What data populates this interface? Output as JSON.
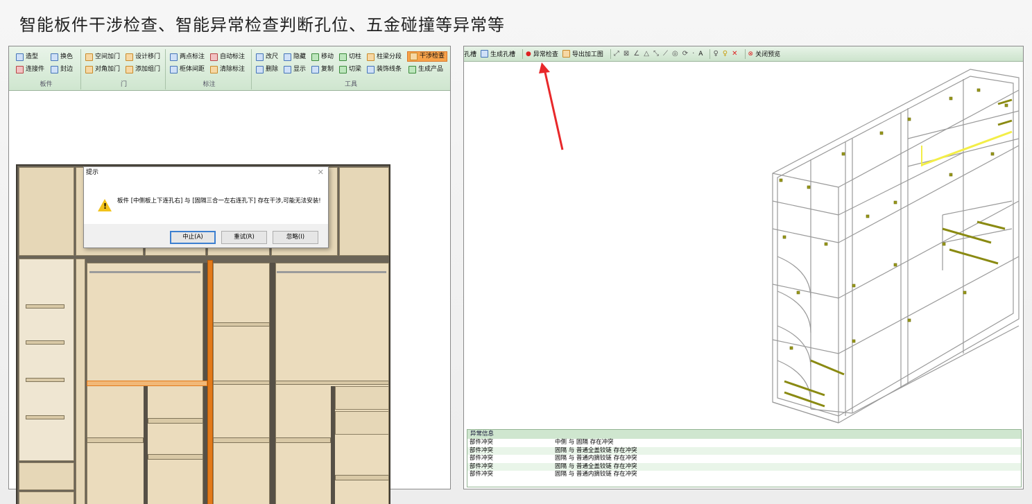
{
  "slide_title": "智能板件干涉检查、智能异常检查判断孔位、五金碰撞等异常等",
  "left_app": {
    "ribbon": {
      "groups": [
        {
          "label": "板件",
          "buttons": [
            "造型",
            "换色",
            "连接件",
            "封边"
          ]
        },
        {
          "label": "门",
          "buttons": [
            "空间加门",
            "设计移门",
            "对角加门",
            "添加组门"
          ]
        },
        {
          "label": "标注",
          "buttons": [
            "两点标注",
            "自动标注",
            "柜体间距",
            "清除标注"
          ]
        },
        {
          "label": "工具",
          "buttons": [
            "改尺",
            "隐藏",
            "移动",
            "切柱",
            "柱梁分段",
            "干涉检查",
            "删除",
            "显示",
            "复制",
            "切梁",
            "装饰线条",
            "生成产品"
          ]
        }
      ]
    },
    "dialog": {
      "title": "提示",
      "message": "板件 [中侧板上下连孔右] 与 [固隔三合一左右连孔下] 存在干涉,可能无法安装!",
      "buttons": [
        "中止(A)",
        "重试(R)",
        "忽略(I)"
      ]
    }
  },
  "right_app": {
    "toolbar": {
      "items": [
        "孔槽",
        "生成孔槽",
        "异常检查",
        "导出加工图",
        "A",
        "关闭预览"
      ]
    },
    "error_panel": {
      "header": "异常信息",
      "rows": [
        {
          "type": "部件冲突",
          "desc": "中侧 与 固隔 存在冲突"
        },
        {
          "type": "部件冲突",
          "desc": "固隔 与 普通全盖铰链 存在冲突"
        },
        {
          "type": "部件冲突",
          "desc": "固隔 与 普通内摘铰链 存在冲突"
        },
        {
          "type": "部件冲突",
          "desc": "固隔 与 普通全盖铰链 存在冲突"
        },
        {
          "type": "部件冲突",
          "desc": "固隔 与 普通内摘铰链 存在冲突"
        }
      ]
    }
  },
  "colors": {
    "accent_orange": "#e27a1a",
    "ribbon_green": "#cfe6cf",
    "arrow_red": "#e8282a",
    "hinge": "#9a9a1a"
  }
}
